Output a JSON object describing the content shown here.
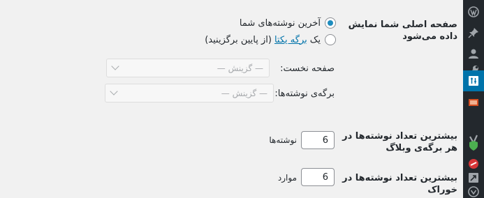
{
  "settings": {
    "front_page_displays": {
      "label": "صفحه اصلی شما نمایش داده می‌شود",
      "option_latest": "آخرین نوشته‌های شما",
      "option_static_prefix": "یک",
      "option_static_link": "برگه یکتا",
      "option_static_suffix": "(از پایین برگزینید)",
      "front_page_label": "صفحه نخست:",
      "front_page_placeholder": "— گزینش —",
      "posts_page_label": "برگه‌ی نوشته‌ها:",
      "posts_page_placeholder": "— گزینش —"
    },
    "posts_per_page": {
      "label": "بیشترین تعداد نوشته‌ها در هر برگه‌ی وبلاگ",
      "value": "6",
      "unit": "نوشته‌ها"
    },
    "posts_per_rss": {
      "label": "بیشترین تعداد نوشته‌ها در خوراک",
      "value": "6",
      "unit": "موارد"
    }
  },
  "sidebar": {
    "icons": [
      "wordpress-icon",
      "pin-icon",
      "user-icon",
      "wrench-icon",
      "settings-icon",
      "gallery-icon",
      "yoast-icon",
      "shield-icon",
      "slider-icon",
      "share-icon",
      "collapse-icon"
    ],
    "active": "settings-icon",
    "accent": "#0073aa"
  }
}
